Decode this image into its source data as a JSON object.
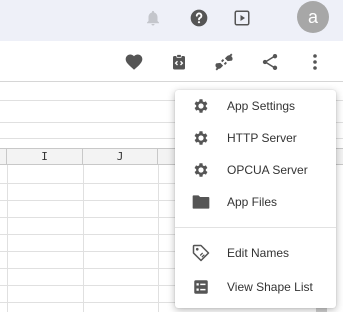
{
  "topbar": {
    "icons": [
      "bell-icon",
      "help-icon",
      "play-box-icon"
    ],
    "avatar_letter": "a"
  },
  "toolbar": {
    "icons": [
      "heart-icon",
      "clipboard-code-icon",
      "plug-icon",
      "share-icon",
      "more-vert-icon"
    ]
  },
  "sheet": {
    "columns": [
      "I",
      "J"
    ]
  },
  "menu": {
    "items": [
      {
        "label": "App Settings",
        "icon": "gear-icon"
      },
      {
        "label": "HTTP Server",
        "icon": "gear-icon"
      },
      {
        "label": "OPCUA Server",
        "icon": "gear-icon"
      },
      {
        "label": "App Files",
        "icon": "folder-icon"
      },
      {
        "label": "Edit Names",
        "icon": "tag-icon"
      },
      {
        "label": "View Shape List",
        "icon": "list-box-icon"
      }
    ]
  },
  "colors": {
    "topbar_bg": "#eef0f8",
    "icon": "#555555",
    "avatar_bg": "#a7a7a7"
  }
}
